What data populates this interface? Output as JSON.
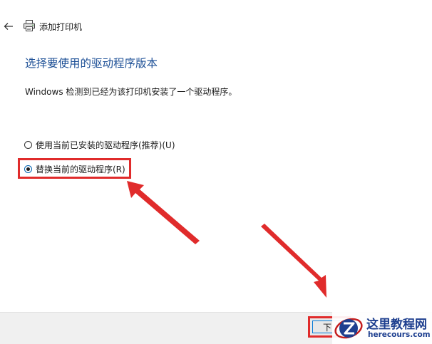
{
  "window": {
    "title": "添加打印机",
    "back_icon": "back-arrow-icon",
    "printer_icon": "printer-icon"
  },
  "main": {
    "heading": "选择要使用的驱动程序版本",
    "description": "Windows 检测到已经为该打印机安装了一个驱动程序。",
    "options": [
      {
        "label": "使用当前已安装的驱动程序(推荐)(U)",
        "selected": false
      },
      {
        "label": "替换当前的驱动程序(R)",
        "selected": true
      }
    ]
  },
  "footer": {
    "next_label": "下"
  },
  "watermark": {
    "title": "这里教程网",
    "url": "herecours.com",
    "logo_letter": "Z"
  },
  "colors": {
    "heading": "#1c4f96",
    "annotation_red": "#e02b2b",
    "footer_bg": "#f0f0f0",
    "watermark_blue": "#1e3f8f"
  }
}
